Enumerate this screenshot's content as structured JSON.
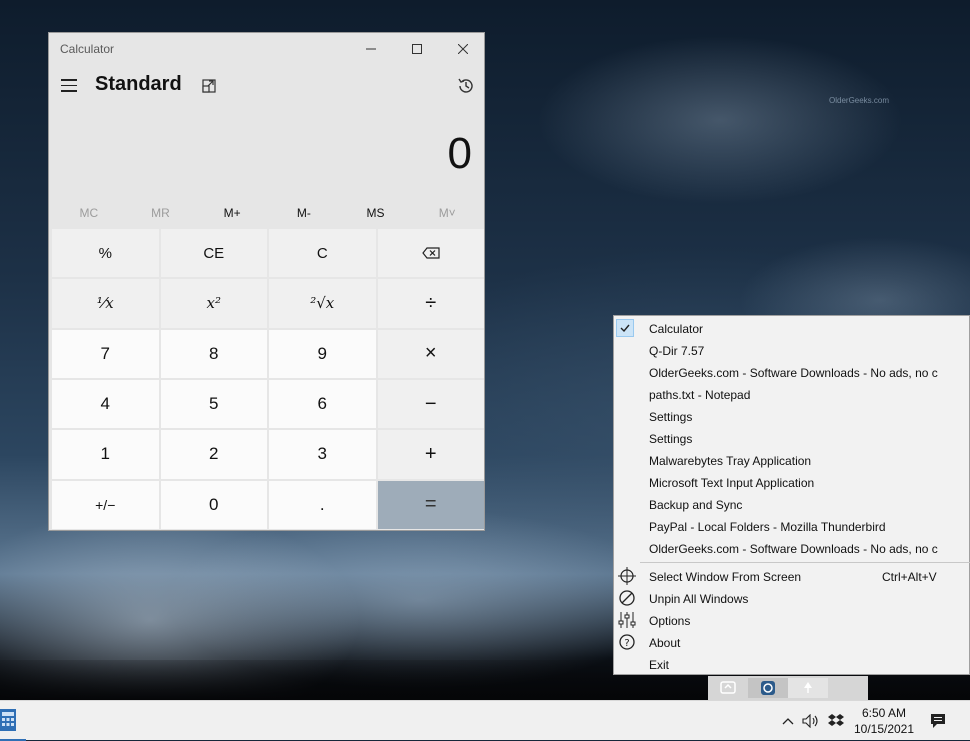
{
  "desktop": {
    "watermark": "OlderGeeks.com"
  },
  "calculator": {
    "window_title": "Calculator",
    "mode": "Standard",
    "display": "0",
    "memory": [
      {
        "label": "MC",
        "enabled": false
      },
      {
        "label": "MR",
        "enabled": false
      },
      {
        "label": "M+",
        "enabled": true
      },
      {
        "label": "M-",
        "enabled": true
      },
      {
        "label": "MS",
        "enabled": true
      },
      {
        "label": "M˅",
        "enabled": false
      }
    ],
    "keys": {
      "percent": "%",
      "ce": "CE",
      "c": "C",
      "backspace": "⌫",
      "reciprocal": "¹⁄x",
      "square": "x²",
      "sqrt": "²√x",
      "divide": "÷",
      "k7": "7",
      "k8": "8",
      "k9": "9",
      "multiply": "×",
      "k4": "4",
      "k5": "5",
      "k6": "6",
      "minus": "−",
      "k1": "1",
      "k2": "2",
      "k3": "3",
      "plus": "+",
      "negate": "+/−",
      "k0": "0",
      "decimal": ".",
      "equals": "="
    }
  },
  "menu": {
    "windows": [
      "Calculator",
      "Q-Dir 7.57",
      "OlderGeeks.com - Software Downloads - No ads, no c",
      "paths.txt - Notepad",
      "Settings",
      "Settings",
      "Malwarebytes Tray Application",
      "Microsoft Text Input Application",
      "Backup and Sync",
      "PayPal - Local Folders - Mozilla Thunderbird",
      "OlderGeeks.com - Software Downloads - No ads, no c"
    ],
    "select_window": "Select Window From Screen",
    "select_shortcut": "Ctrl+Alt+V",
    "unpin": "Unpin All Windows",
    "options": "Options",
    "about": "About",
    "exit": "Exit"
  },
  "taskbar": {
    "time": "6:50 AM",
    "date": "10/15/2021"
  },
  "colors": {
    "equals_key": "#9eacb9",
    "checked_bg": "#cce4f7",
    "taskbar_accent": "#2f6fb5"
  }
}
